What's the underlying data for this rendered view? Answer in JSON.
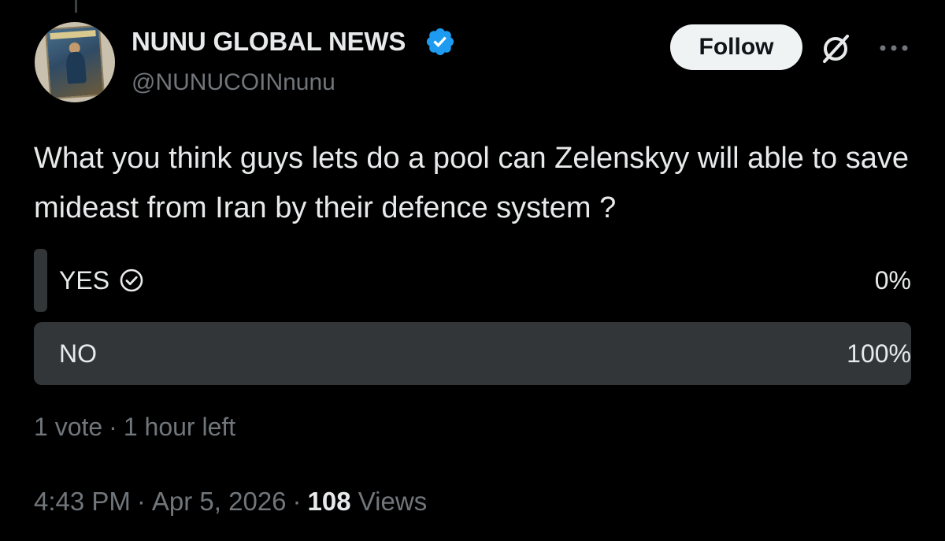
{
  "author": {
    "name": "NUNU GLOBAL NEWS",
    "handle": "@NUNUCOINnunu",
    "avatar_text": "NUNU MAG"
  },
  "actions": {
    "follow_label": "Follow",
    "grok_icon": "grok-icon",
    "more_icon": "more-dots-icon"
  },
  "tweet": {
    "text": "What you think guys lets do a pool can Zelenskyy will able to save mideast from Iran by their defence system ?"
  },
  "poll": {
    "options": [
      {
        "label": "YES",
        "percent_text": "0%",
        "percent": 0,
        "selected": true
      },
      {
        "label": "NO",
        "percent_text": "100%",
        "percent": 100,
        "selected": false
      }
    ],
    "votes": "1 vote",
    "time_left": "1 hour left"
  },
  "meta": {
    "time": "4:43 PM",
    "date": "Apr 5, 2026",
    "views_count": "108",
    "views_label": "Views",
    "separator": "·"
  },
  "colors": {
    "background": "#000000",
    "text": "#e7e9ea",
    "secondary": "#71767b",
    "poll_fill": "#333639",
    "verified": "#1d9bf0"
  }
}
